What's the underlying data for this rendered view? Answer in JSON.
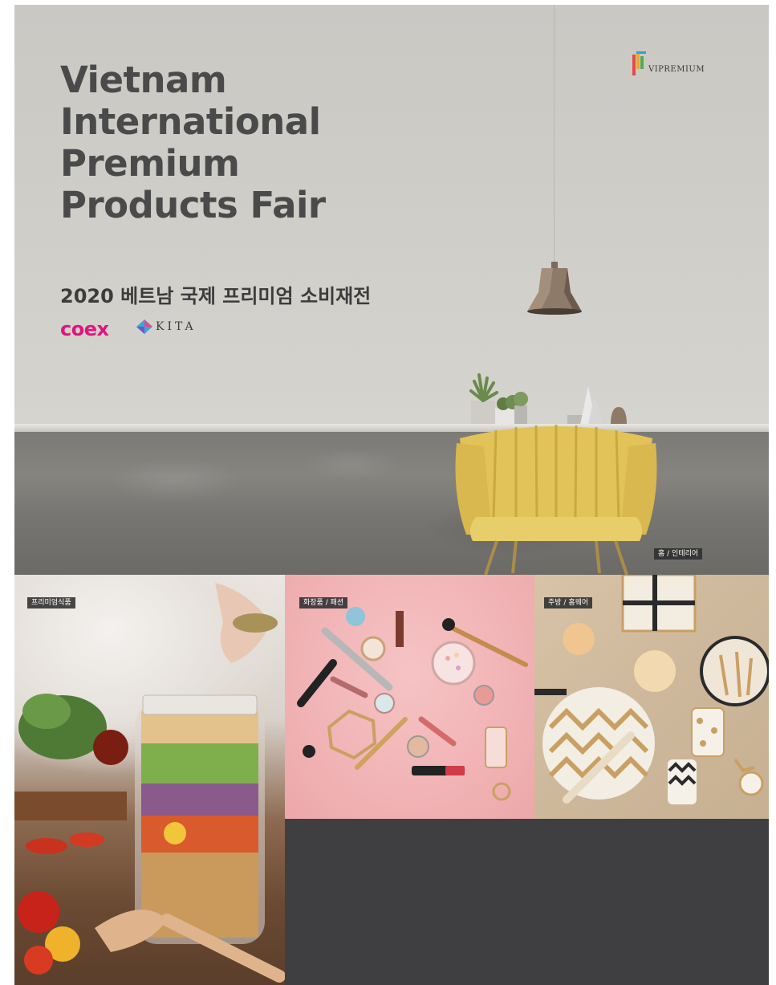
{
  "poster": {
    "title": "Vietnam\nInternational\nPremium\nProducts Fair",
    "subtitle": "2020 베트남 국제 프리미엄 소비재전",
    "logos": {
      "coex": "coex",
      "kita": "KITA",
      "vip": "VIPREMIUM"
    }
  },
  "categories": {
    "home_interior": "홈 / 인테리어",
    "premium_food": "프리미엄식품",
    "cosmetics_fashion": "화장품 / 패션",
    "kitchen_hobby": "주방 / 홈웨어"
  },
  "colors": {
    "title": "#4a4a4a",
    "coex": "#e0157f",
    "bottom_panel": "#3f3f41",
    "cosmetics_bg": "#f1b3b5"
  }
}
